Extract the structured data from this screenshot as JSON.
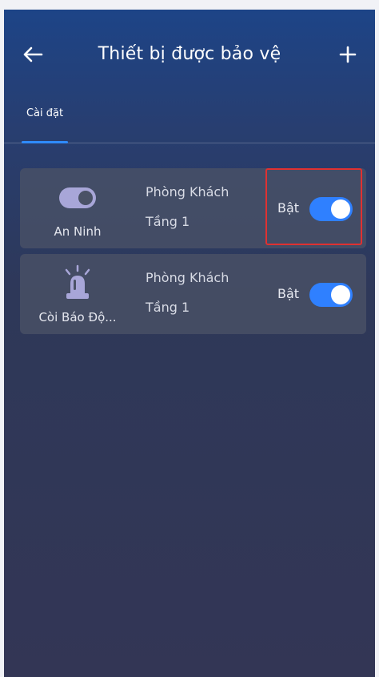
{
  "header": {
    "title": "Thiết bị được bảo vệ",
    "back_icon": "arrow-left-icon",
    "add_icon": "plus-icon"
  },
  "tabs": [
    {
      "label": "Cài đặt",
      "active": true
    }
  ],
  "devices": [
    {
      "name": "An Ninh",
      "icon": "toggle-switch-icon",
      "room": "Phòng Khách",
      "floor": "Tầng 1",
      "state_label": "Bật",
      "enabled": true
    },
    {
      "name": "Còi Báo Độ...",
      "icon": "siren-icon",
      "room": "Phòng Khách",
      "floor": "Tầng 1",
      "state_label": "Bật",
      "enabled": true
    }
  ],
  "colors": {
    "accent": "#2f80ff",
    "highlight": "#e03131"
  }
}
